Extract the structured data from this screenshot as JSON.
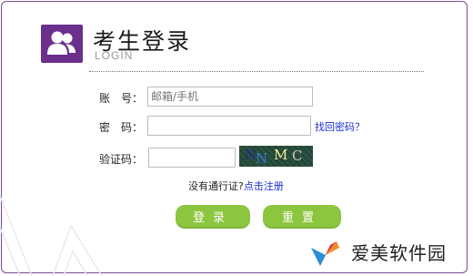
{
  "header": {
    "title": "考生登录",
    "subtitle": "LOGIN",
    "icon": "users-icon"
  },
  "form": {
    "account_label": "账　号：",
    "account_placeholder": "邮箱/手机",
    "password_label": "密　码：",
    "forgot_link": "找回密码？",
    "captcha_label": "验证码：",
    "captcha_chars": [
      "N",
      "N",
      "M",
      "C"
    ]
  },
  "register": {
    "prompt": "没有通行证?",
    "link": "点击注册"
  },
  "buttons": {
    "login": "登录",
    "reset": "重置"
  },
  "watermark": {
    "text": "爱美软件园"
  },
  "colors": {
    "brand_purple": "#6b2f8c",
    "button_green": "#8cc63f",
    "link_blue": "#1b2fd4"
  }
}
